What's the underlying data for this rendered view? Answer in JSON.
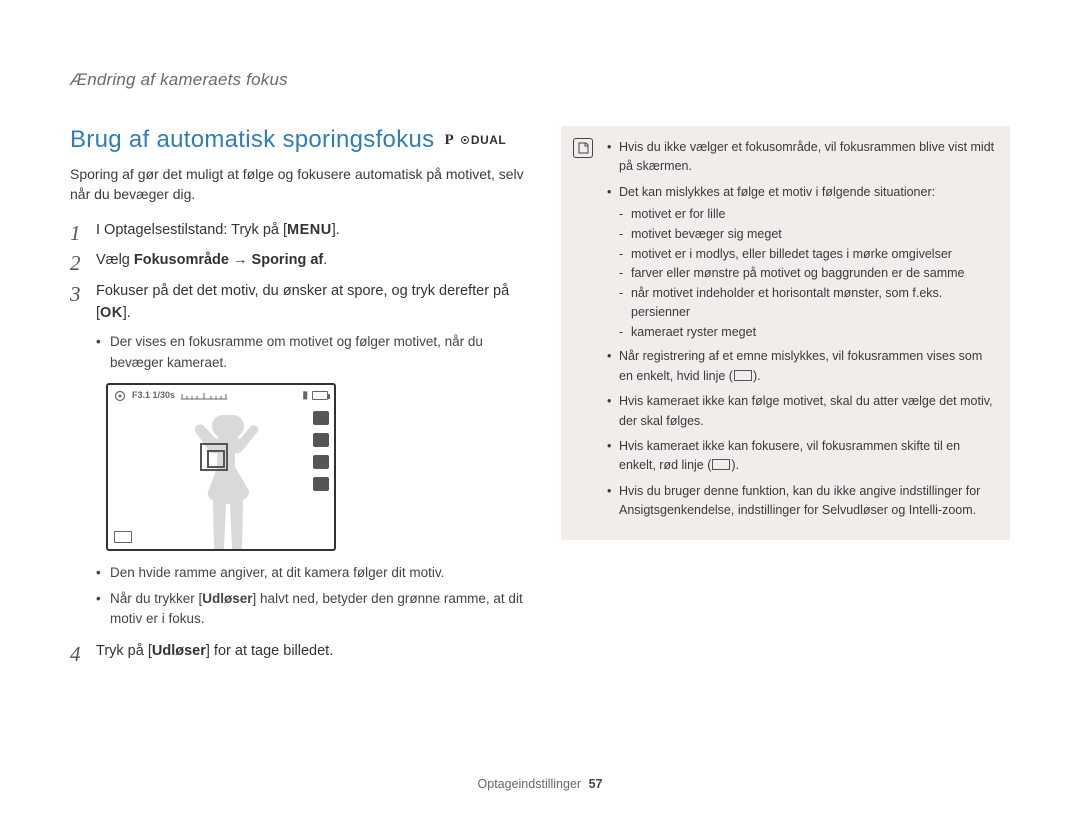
{
  "breadcrumb": "Ændring af kameraets fokus",
  "section_title": "Brug af automatisk sporingsfokus",
  "mode_p": "P",
  "mode_dual": "DUAL",
  "intro": "Sporing af gør det muligt at følge og fokusere automatisk på motivet, selv når du bevæger dig.",
  "steps": {
    "s1_a": "I Optagelsestilstand: Tryk på [",
    "s1_kbd": "MENU",
    "s1_b": "].",
    "s2_a": "Vælg ",
    "s2_b": "Fokusområde",
    "s2_c": " → ",
    "s2_d": "Sporing af",
    "s2_e": ".",
    "s3_a": "Fokuser på det det motiv, du ønsker at spore, og tryk derefter på [",
    "s3_kbd": "OK",
    "s3_b": "].",
    "s3_sub1": "Der vises en fokusramme om motivet og følger motivet, når du bevæger kameraet.",
    "s3_sub2": "Den hvide ramme angiver, at dit kamera følger dit motiv.",
    "s3_sub3_a": "Når du trykker [",
    "s3_sub3_b": "Udløser",
    "s3_sub3_c": "] halvt ned, betyder den grønne ramme, at dit motiv er i fokus.",
    "s4_a": "Tryk på [",
    "s4_b": "Udløser",
    "s4_c": "] for at tage billedet."
  },
  "lcd_text": "F3.1  1/30s",
  "info": {
    "i1": "Hvis du ikke vælger et fokusområde, vil fokusrammen blive vist midt på skærmen.",
    "i2_lead": "Det kan mislykkes at følge et motiv i følgende situationer:",
    "i2": [
      "motivet er for lille",
      "motivet bevæger sig meget",
      "motivet er i modlys, eller billedet tages i mørke omgivelser",
      "farver eller mønstre på motivet og baggrunden er de samme",
      "når motivet indeholder et horisontalt mønster, som f.eks. persienner",
      "kameraet ryster meget"
    ],
    "i3_a": "Når registrering af et emne mislykkes, vil fokusrammen vises som en enkelt, hvid linje (",
    "i3_b": ").",
    "i4": "Hvis kameraet ikke kan følge motivet, skal du atter vælge det motiv, der skal følges.",
    "i5_a": "Hvis kameraet ikke kan fokusere, vil fokusrammen skifte til en enkelt, rød linje (",
    "i5_b": ").",
    "i6": "Hvis du bruger denne funktion, kan du ikke angive indstillinger for Ansigtsgenkendelse, indstillinger for Selvudløser og Intelli-zoom."
  },
  "footer_label": "Optageindstillinger",
  "footer_page": "57"
}
